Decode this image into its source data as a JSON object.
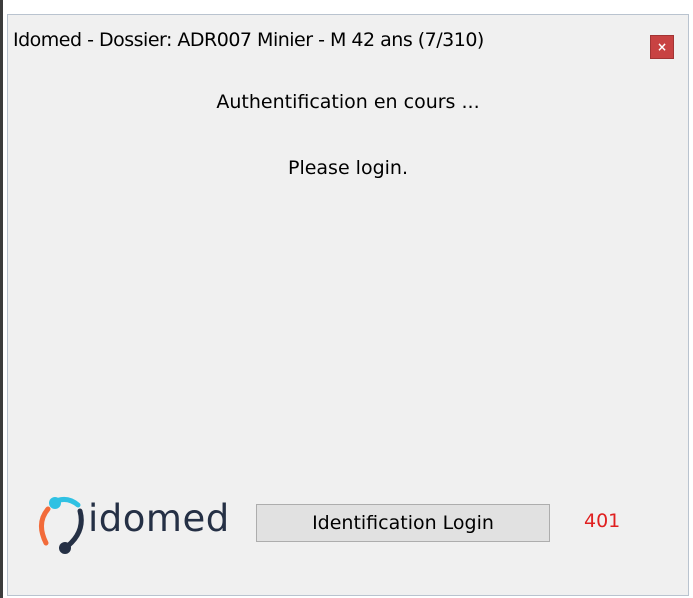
{
  "window": {
    "title": "Idomed - Dossier: ADR007 Minier - M 42 ans (7/310)",
    "close_label": "×"
  },
  "content": {
    "status_main": "Authentification en cours ...",
    "status_sub": "Please login."
  },
  "footer": {
    "logo_text": "idomed",
    "login_button_label": "Identification Login",
    "error_code": "401"
  },
  "colors": {
    "close_button": "#c84242",
    "error_code": "#e02020",
    "logo_orange": "#f26b3a",
    "logo_teal": "#2fc1e3",
    "logo_navy": "#253045"
  }
}
